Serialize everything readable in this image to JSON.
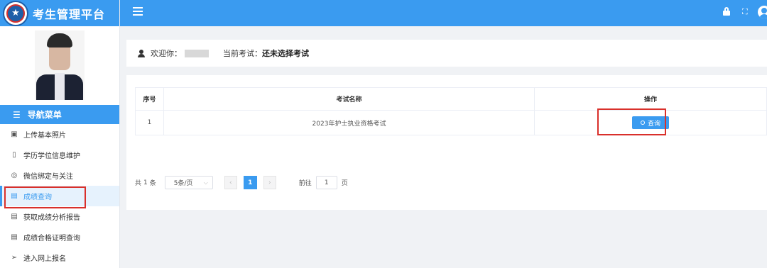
{
  "app": {
    "title": "考生管理平台"
  },
  "sidebar": {
    "nav_title": "导航菜单",
    "items": [
      {
        "label": "上传基本照片",
        "icon": "image-icon",
        "active": false
      },
      {
        "label": "学历学位信息维护",
        "icon": "book-icon",
        "active": false
      },
      {
        "label": "微信绑定与关注",
        "icon": "wechat-icon",
        "active": false
      },
      {
        "label": "成绩查询",
        "icon": "document-icon",
        "active": true
      },
      {
        "label": "获取成绩分析报告",
        "icon": "report-icon",
        "active": false
      },
      {
        "label": "成绩合格证明查询",
        "icon": "certificate-icon",
        "active": false
      },
      {
        "label": "进入网上报名",
        "icon": "send-icon",
        "active": false
      }
    ]
  },
  "header": {
    "icons": [
      "menu-icon",
      "lock-icon",
      "fullscreen-icon",
      "user-icon"
    ]
  },
  "welcome": {
    "greeting": "欢迎你：",
    "current_exam_label": "当前考试：",
    "current_exam_value": "还未选择考试"
  },
  "table": {
    "headers": [
      "序号",
      "考试名称",
      "操作"
    ],
    "rows": [
      {
        "no": "1",
        "name": "2023年护士执业资格考试",
        "action": "查询"
      }
    ]
  },
  "pagination": {
    "total_prefix": "共",
    "total": "1",
    "total_suffix": "条",
    "page_size": "5条/页",
    "current_page": "1",
    "goto_label": "前往",
    "goto_value": "1",
    "page_suffix": "页"
  },
  "colors": {
    "primary": "#3a9bf0",
    "highlight": "#d9302b",
    "background": "#f0f2f5"
  }
}
